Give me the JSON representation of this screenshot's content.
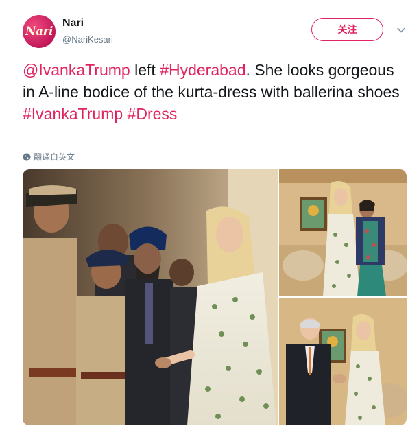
{
  "tweet": {
    "author": {
      "avatar_text": "Nari",
      "display_name": "Nari",
      "handle": "@NariKesari"
    },
    "follow_label": "关注",
    "text_parts": [
      {
        "text": "@IvankaTrump",
        "link": true
      },
      {
        "text": " left ",
        "link": false
      },
      {
        "text": "#Hyderabad",
        "link": true
      },
      {
        "text": ". She looks gorgeous in A-line bodice of the kurta-dress with ballerina shoes",
        "link": false
      },
      {
        "text": "#IvankaTrump",
        "link": true,
        "newline_before": true
      },
      {
        "text": " ",
        "link": false
      },
      {
        "text": "#Dress",
        "link": true
      }
    ],
    "translate_label": "翻译自英文",
    "photos": [
      "photo-main",
      "photo-top-right",
      "photo-bottom-right"
    ]
  },
  "colors": {
    "accent": "#e0245e",
    "text": "#14171a",
    "secondary": "#657786"
  },
  "icons": {
    "menu": "chevron-down-icon",
    "translate": "globe-icon"
  }
}
